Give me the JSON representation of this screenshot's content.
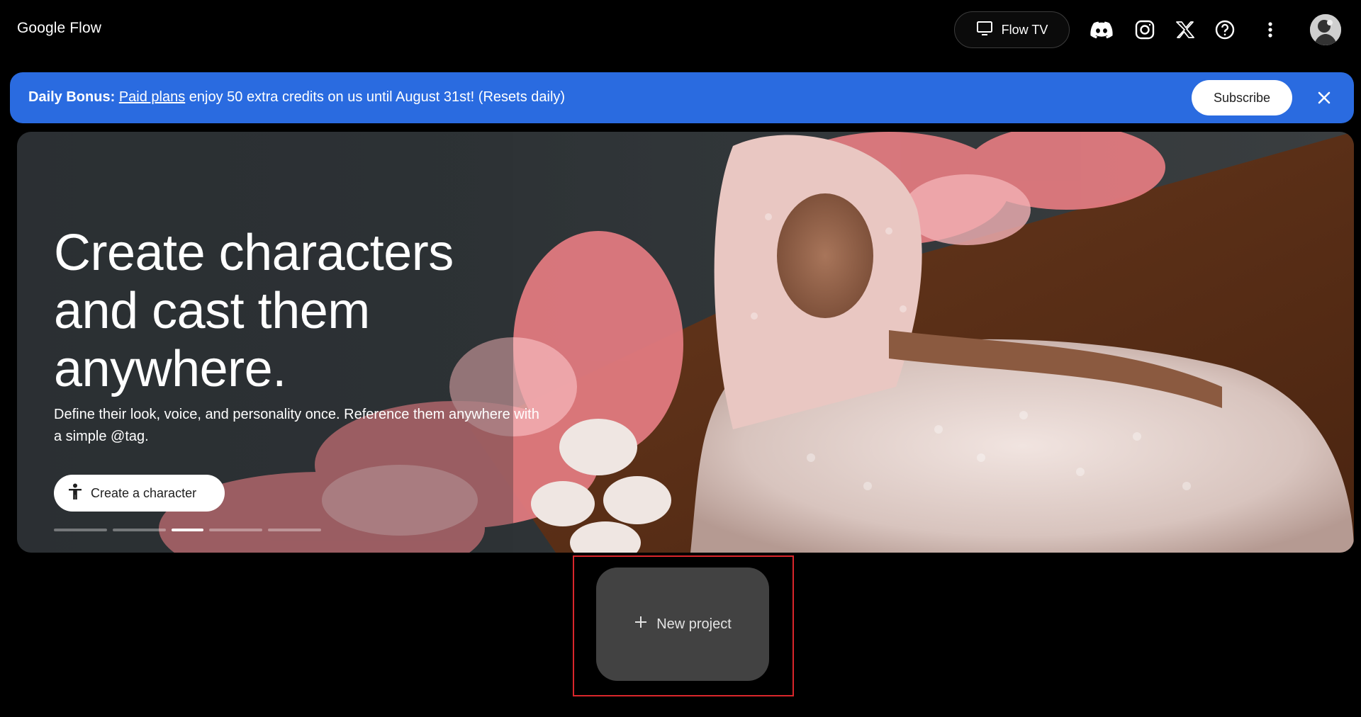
{
  "header": {
    "app_title": "Google Flow",
    "flow_tv_label": "Flow TV",
    "icons": [
      "tv-icon",
      "discord-icon",
      "instagram-icon",
      "x-icon",
      "help-icon",
      "more-vert-icon",
      "avatar"
    ]
  },
  "banner": {
    "bold_prefix": "Daily Bonus:",
    "link_text": "Paid plans",
    "message": "enjoy 50 extra credits on us until August 31st! (Resets daily)",
    "subscribe_label": "Subscribe",
    "color": "#2a6be0"
  },
  "hero": {
    "title": "Create characters and cast them anywhere.",
    "description": "Define their look, voice, and personality once. Reference them anywhere with a simple @tag.",
    "cta_label": "Create a character",
    "carousel": {
      "slides": 5,
      "active_index": 2
    }
  },
  "main": {
    "new_project_label": "New project"
  },
  "colors": {
    "background": "#000000",
    "card": "#424242",
    "highlight": "#d9262b"
  }
}
